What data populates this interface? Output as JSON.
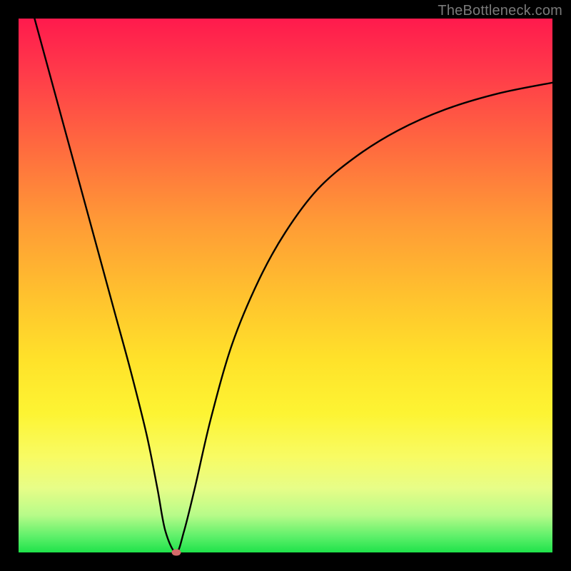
{
  "watermark": "TheBottleneck.com",
  "chart_data": {
    "type": "line",
    "title": "",
    "xlabel": "",
    "ylabel": "",
    "xlim": [
      0,
      100
    ],
    "ylim": [
      0,
      100
    ],
    "gradient_stops": [
      {
        "pos": 0,
        "color": "#ff1a4d"
      },
      {
        "pos": 10,
        "color": "#ff3a4a"
      },
      {
        "pos": 24,
        "color": "#ff6a3f"
      },
      {
        "pos": 38,
        "color": "#ff9a36"
      },
      {
        "pos": 52,
        "color": "#ffc22e"
      },
      {
        "pos": 64,
        "color": "#ffe22a"
      },
      {
        "pos": 74,
        "color": "#fdf433"
      },
      {
        "pos": 82,
        "color": "#f8fb63"
      },
      {
        "pos": 88,
        "color": "#e7fd88"
      },
      {
        "pos": 93,
        "color": "#b7fb89"
      },
      {
        "pos": 97,
        "color": "#5ef06a"
      },
      {
        "pos": 100,
        "color": "#1fe24a"
      }
    ],
    "series": [
      {
        "name": "bottleneck-curve",
        "x": [
          3,
          6,
          9,
          12,
          15,
          18,
          21,
          24,
          26,
          27.5,
          29.5,
          31,
          33,
          36,
          40,
          45,
          50,
          56,
          63,
          71,
          80,
          90,
          100
        ],
        "y": [
          100,
          89,
          78,
          67,
          56,
          45,
          34,
          22,
          12,
          4,
          0,
          4,
          12,
          25,
          39,
          51,
          60,
          68,
          74,
          79,
          83,
          86,
          88
        ]
      }
    ],
    "marker": {
      "x": 29.5,
      "y": 0,
      "color": "#d46a6a"
    }
  }
}
